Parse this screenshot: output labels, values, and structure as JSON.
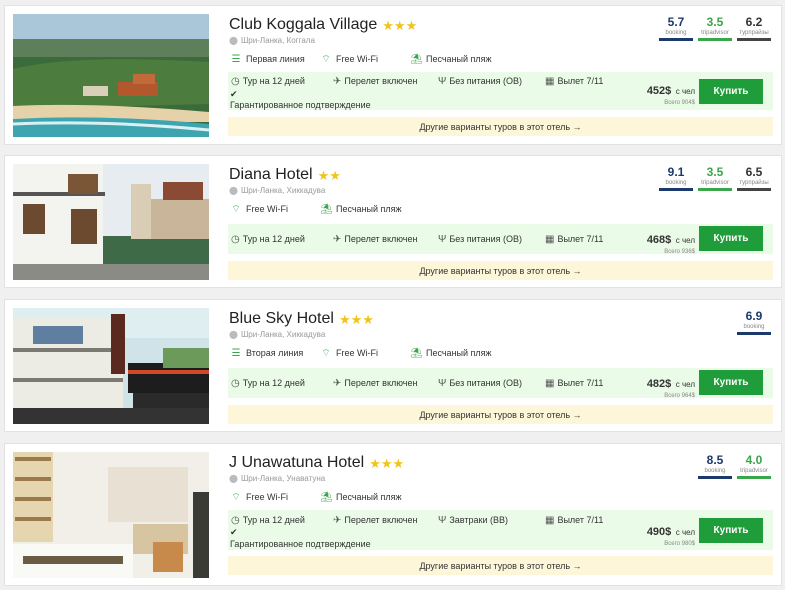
{
  "colors": {
    "accent": "#1f9d3a",
    "green_bg": "#eafbe7",
    "star": "#f0c419",
    "other_bg": "#fdf6d8",
    "booking": "#1b3a6b",
    "tripadvisor": "#3aa54a"
  },
  "hotels": [
    {
      "name": "Club Koggala Village",
      "star_count": 3,
      "location": "Шри-Ланка, Коггала",
      "features": [
        "Первая линия",
        "Free Wi-Fi",
        "Песчаный пляж"
      ],
      "tour": {
        "duration": "Тур на 12 дней",
        "flight": "Перелет включен",
        "meals": "Без питания (ОВ)",
        "departure": "Вылет 7/11"
      },
      "guarantee": "Гарантированное подтверждение",
      "price": "452$",
      "price_per": "с чел",
      "price_total": "Всего 904$",
      "buy_label": "Купить",
      "other_label": "Другие варианты туров в этот отель →",
      "ratings": [
        {
          "value": "5.7",
          "label": "booking"
        },
        {
          "value": "3.5",
          "label": "tripadvisor"
        },
        {
          "value": "6.2",
          "label": "турпрайзы"
        }
      ]
    },
    {
      "name": "Diana Hotel",
      "star_count": 2,
      "location": "Шри-Ланка, Хиккадува",
      "features": [
        "Free Wi-Fi",
        "Песчаный пляж"
      ],
      "tour": {
        "duration": "Тур на 12 дней",
        "flight": "Перелет включен",
        "meals": "Без питания (ОВ)",
        "departure": "Вылет 7/11"
      },
      "price": "468$",
      "price_per": "с чел",
      "price_total": "Всего 936$",
      "buy_label": "Купить",
      "other_label": "Другие варианты туров в этот отель →",
      "ratings": [
        {
          "value": "9.1",
          "label": "booking"
        },
        {
          "value": "3.5",
          "label": "tripadvisor"
        },
        {
          "value": "6.5",
          "label": "турпрайзы"
        }
      ]
    },
    {
      "name": "Blue Sky Hotel",
      "star_count": 3,
      "location": "Шри-Ланка, Хиккадува",
      "features": [
        "Вторая линия",
        "Free Wi-Fi",
        "Песчаный пляж"
      ],
      "tour": {
        "duration": "Тур на 12 дней",
        "flight": "Перелет включен",
        "meals": "Без питания (ОВ)",
        "departure": "Вылет 7/11"
      },
      "price": "482$",
      "price_per": "с чел",
      "price_total": "Всего 964$",
      "buy_label": "Купить",
      "other_label": "Другие варианты туров в этот отель →",
      "ratings": [
        {
          "value": "6.9",
          "label": "booking"
        }
      ]
    },
    {
      "name": "J Unawatuna Hotel",
      "star_count": 3,
      "location": "Шри-Ланка, Унаватуна",
      "features": [
        "Free Wi-Fi",
        "Песчаный пляж"
      ],
      "tour": {
        "duration": "Тур на 12 дней",
        "flight": "Перелет включен",
        "meals": "Завтраки (BB)",
        "departure": "Вылет 7/11"
      },
      "guarantee": "Гарантированное подтверждение",
      "price": "490$",
      "price_per": "с чел",
      "price_total": "Всего 980$",
      "buy_label": "Купить",
      "other_label": "Другие варианты туров в этот отель →",
      "ratings": [
        {
          "value": "8.5",
          "label": "booking"
        },
        {
          "value": "4.0",
          "label": "tripadvisor"
        }
      ]
    }
  ]
}
